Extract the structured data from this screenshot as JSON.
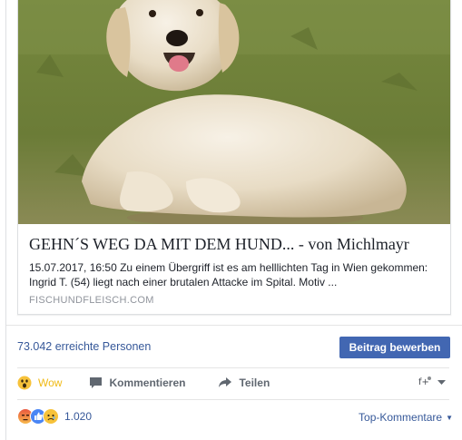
{
  "link": {
    "title": "GEHN´S WEG DA MIT DEM HUND... - von Michlmayr",
    "description": "15.07.2017, 16:50 Zu einem Übergriff ist es am helllichten Tag in Wien gekommen: Ingrid T. (54) liegt nach einer brutalen Attacke im Spital. Motiv ...",
    "domain": "FISCHUNDFLEISCH.COM"
  },
  "stats": {
    "reach": "73.042 erreichte Personen",
    "boost_label": "Beitrag bewerben"
  },
  "actions": {
    "wow_label": "Wow",
    "comment_label": "Kommentieren",
    "share_label": "Teilen"
  },
  "reactions": {
    "count": "1.020",
    "types": [
      "angry",
      "like",
      "sad"
    ]
  },
  "comments": {
    "sort_label": "Top-Kommentare"
  },
  "colors": {
    "link_blue": "#365899",
    "button_blue": "#4267b2",
    "wow_yellow": "#f0ba15",
    "secondary_gray": "#606770"
  },
  "icons": {
    "wow": "wow-emoji-icon",
    "comment": "speech-bubble-icon",
    "share": "share-arrow-icon",
    "page_switch": "page-avatar-icon"
  }
}
